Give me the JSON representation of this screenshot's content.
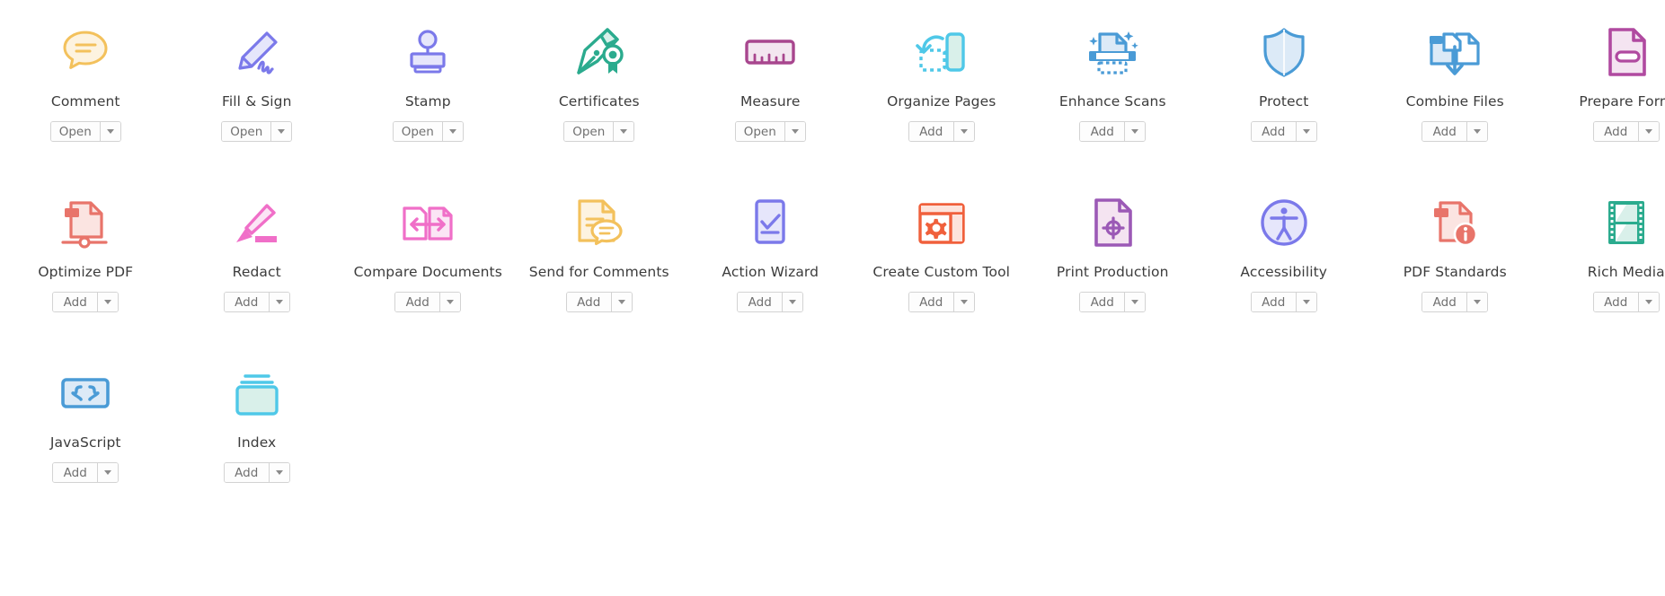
{
  "panel": {
    "name": "acrobat-tools-panel",
    "columns": 10,
    "rows": 3
  },
  "buttons": {
    "open_label": "Open",
    "add_label": "Add",
    "dropdown_icon": "chevron-down-icon"
  },
  "colors": {
    "amber": "#f3c15c",
    "amber_fill": "#fdf3e0",
    "periwinkle": "#7b79ea",
    "periwinkle_fill": "#e6e6fb",
    "teal": "#2bab8e",
    "teal_fill": "#d9f0ea",
    "magenta": "#a8468e",
    "magenta_fill": "#f3e6f0",
    "cyan": "#4fc8e8",
    "cyan_fill": "#e2f6fb",
    "blue": "#4a9bd6",
    "blue_fill": "#dceaf7",
    "orchid": "#b04aa0",
    "orchid_fill": "#f4e4f1",
    "salmon": "#e8746a",
    "salmon_fill": "#fbe4e1",
    "pink": "#f06fc8",
    "pink_fill": "#fbe5f5",
    "orange": "#f0603c",
    "orange_fill": "#fde3dc",
    "purple": "#9b59b6",
    "purple_fill": "#f0e3f4",
    "text": "#3c3c3c",
    "button_text": "#707070",
    "button_border": "#d3d3d3"
  },
  "tools": [
    {
      "label": "Comment",
      "icon": "comment-bubble-icon",
      "action": "Open"
    },
    {
      "label": "Fill & Sign",
      "icon": "pencil-signature-icon",
      "action": "Open"
    },
    {
      "label": "Stamp",
      "icon": "stamp-icon",
      "action": "Open"
    },
    {
      "label": "Certificates",
      "icon": "pen-nib-seal-icon",
      "action": "Open"
    },
    {
      "label": "Measure",
      "icon": "ruler-icon",
      "action": "Open"
    },
    {
      "label": "Organize Pages",
      "icon": "page-rotate-icon",
      "action": "Add"
    },
    {
      "label": "Enhance Scans",
      "icon": "scanner-sparkle-icon",
      "action": "Add"
    },
    {
      "label": "Protect",
      "icon": "shield-icon",
      "action": "Add"
    },
    {
      "label": "Combine Files",
      "icon": "combine-files-icon",
      "action": "Add"
    },
    {
      "label": "Prepare Form",
      "icon": "form-field-doc-icon",
      "action": "Add"
    },
    {
      "label": "Optimize PDF",
      "icon": "optimize-doc-icon",
      "action": "Add"
    },
    {
      "label": "Redact",
      "icon": "highlighter-icon",
      "action": "Add"
    },
    {
      "label": "Compare Documents",
      "icon": "compare-docs-icon",
      "action": "Add"
    },
    {
      "label": "Send for Comments",
      "icon": "doc-comment-icon",
      "action": "Add"
    },
    {
      "label": "Action Wizard",
      "icon": "checklist-page-icon",
      "action": "Add"
    },
    {
      "label": "Create Custom Tool",
      "icon": "window-gear-icon",
      "action": "Add"
    },
    {
      "label": "Print Production",
      "icon": "doc-crosshair-icon",
      "action": "Add"
    },
    {
      "label": "Accessibility",
      "icon": "accessibility-icon",
      "action": "Add"
    },
    {
      "label": "PDF Standards",
      "icon": "doc-info-icon",
      "action": "Add"
    },
    {
      "label": "Rich Media",
      "icon": "film-strip-icon",
      "action": "Add"
    },
    {
      "label": "JavaScript",
      "icon": "code-braces-icon",
      "action": "Add"
    },
    {
      "label": "Index",
      "icon": "index-card-icon",
      "action": "Add"
    }
  ]
}
